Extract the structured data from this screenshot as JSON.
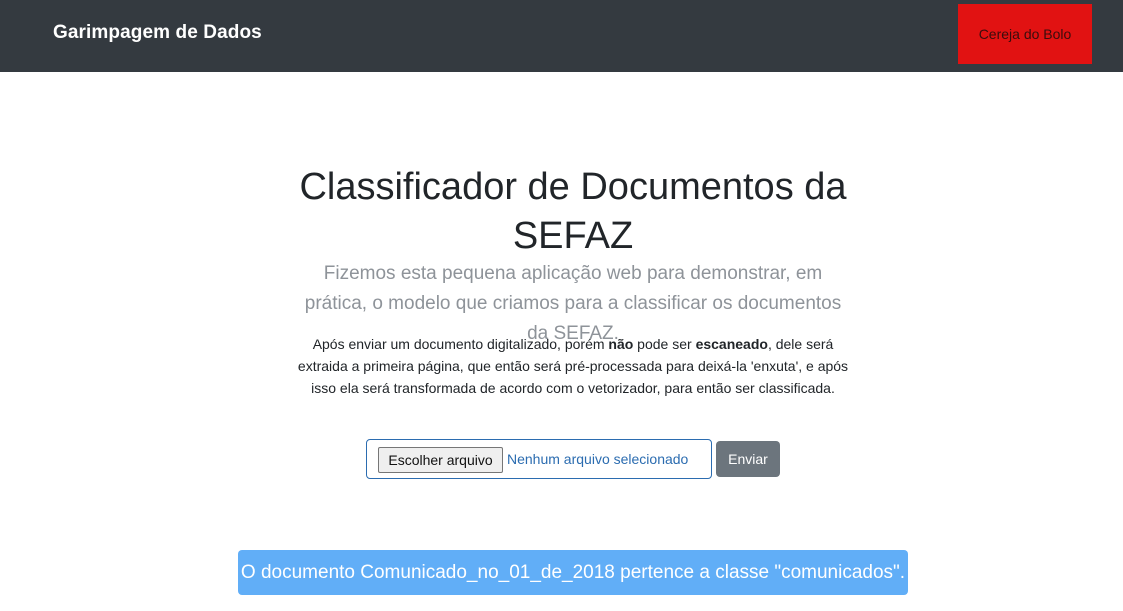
{
  "navbar": {
    "brand": "Garimpagem de Dados",
    "button_label": "Cereja do Bolo",
    "button_color": "#e11212",
    "background_color": "#343a40"
  },
  "main": {
    "title": "Classificador de Documentos da SEFAZ",
    "lead": "Fizemos esta pequena aplicação web para demonstrar, em prática, o modelo que criamos para a classificar os documentos da SEFAZ.",
    "description": {
      "part1": "Após enviar um documento digitalizado, porém ",
      "bold1": "não",
      "part2": " pode ser ",
      "bold2": "escaneado",
      "part3": ", dele será extraida a primeira página, que então será pré-processada para deixá-la 'enxuta', e após isso ela será transformada de acordo com o vetorizador, para então ser classificada."
    }
  },
  "form": {
    "file_button_label": "Escolher arquivo",
    "file_status": "Nenhum arquivo selecionado",
    "submit_label": "Enviar"
  },
  "result": {
    "message": "O documento Comunicado_no_01_de_2018 pertence a classe \"comunicados\".",
    "background_color": "#61aef7"
  }
}
